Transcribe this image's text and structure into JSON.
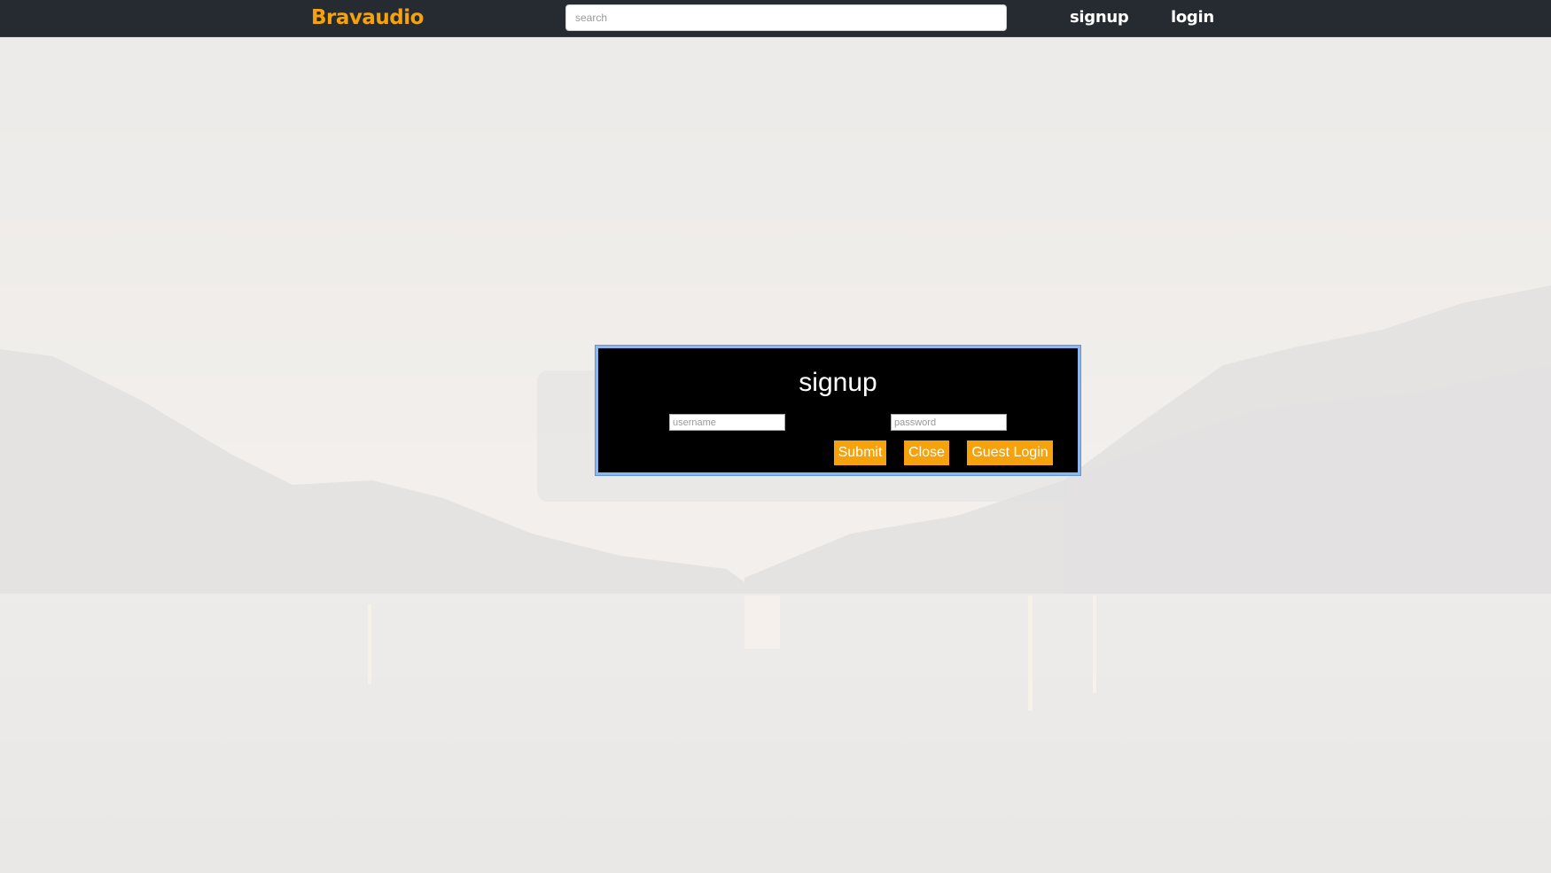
{
  "header": {
    "logo": "Bravaudio",
    "search_placeholder": "search",
    "nav": {
      "signup": "signup",
      "login": "login"
    }
  },
  "modal": {
    "title": "signup",
    "username_placeholder": "username",
    "password_placeholder": "password",
    "buttons": {
      "submit": "Submit",
      "close": "Close",
      "guest": "Guest Login"
    }
  },
  "colors": {
    "topbar": "#262b32",
    "brand": "#f5a20c",
    "modal_bg": "#000000",
    "modal_border": "#8cb8f0"
  }
}
